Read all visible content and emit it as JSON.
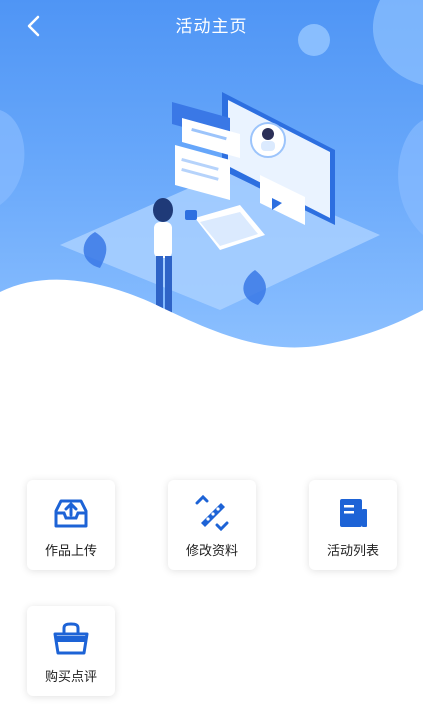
{
  "header": {
    "title": "活动主页"
  },
  "menu": [
    {
      "label": "作品上传",
      "icon": "inbox-upload-icon"
    },
    {
      "label": "修改资料",
      "icon": "pen-edit-icon"
    },
    {
      "label": "活动列表",
      "icon": "notebook-list-icon"
    },
    {
      "label": "购买点评",
      "icon": "shopping-basket-icon"
    }
  ],
  "colors": {
    "accent": "#1d63d6",
    "hero_top": "#4f95f5",
    "hero_bottom": "#8cc0ff"
  }
}
